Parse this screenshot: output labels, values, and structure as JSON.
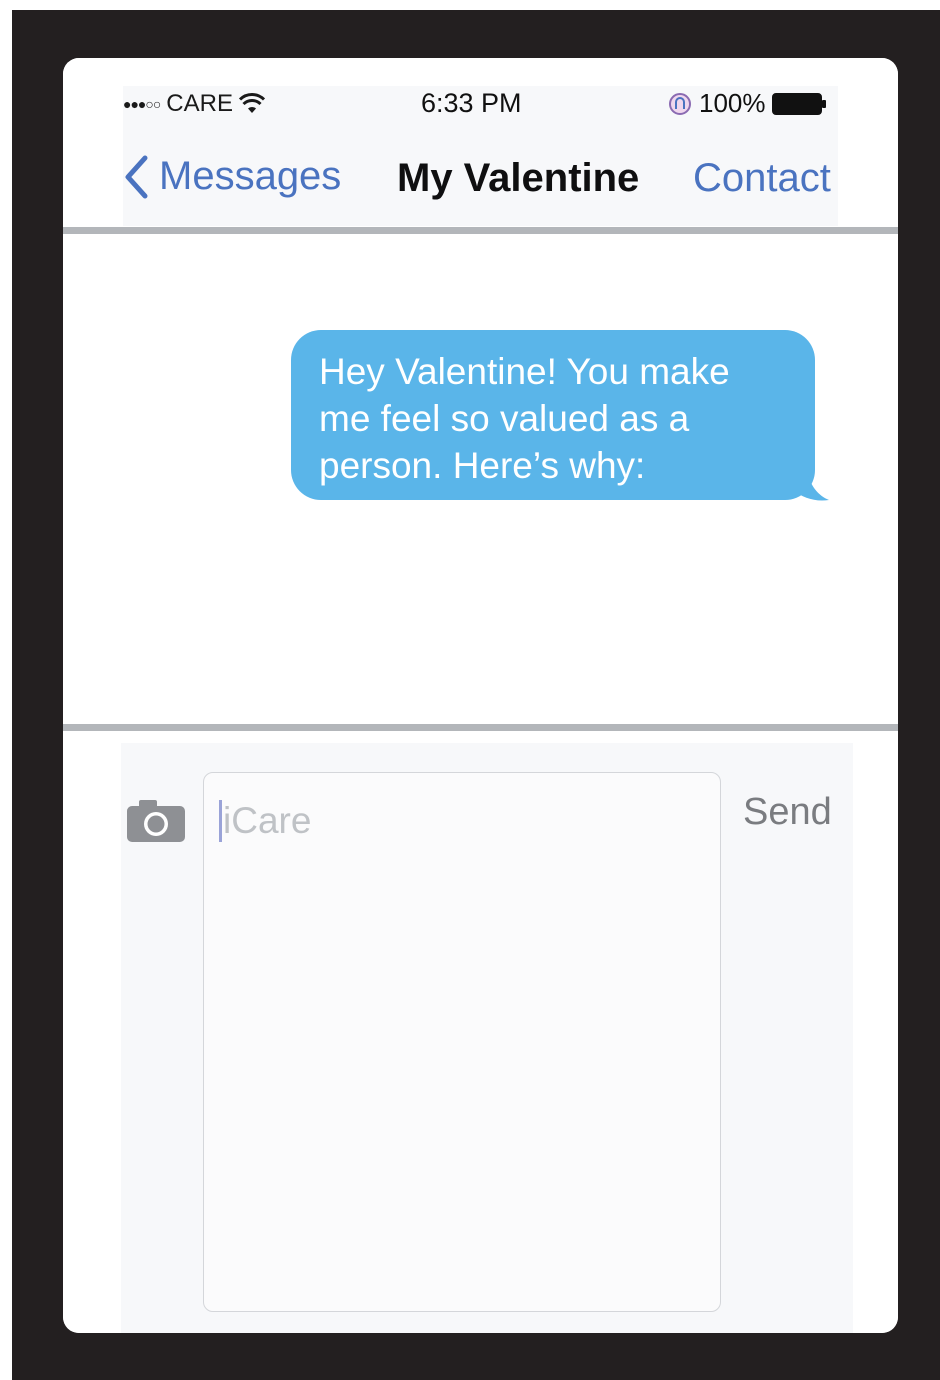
{
  "status_bar": {
    "signal": "●●●○○",
    "carrier": "CARE",
    "time": "6:33 PM",
    "battery": "100%"
  },
  "nav": {
    "back_label": "Messages",
    "title": "My Valentine",
    "right_label": "Contact"
  },
  "messages": [
    {
      "direction": "sent",
      "text": "Hey Valentine! You make me feel so valued as a person. Here’s why:"
    }
  ],
  "compose": {
    "placeholder": "iCare",
    "send_label": "Send",
    "camera_icon": "camera-icon"
  },
  "colors": {
    "link_blue": "#4a73c0",
    "bubble_blue": "#5ab5e9",
    "frame": "#231f20"
  }
}
